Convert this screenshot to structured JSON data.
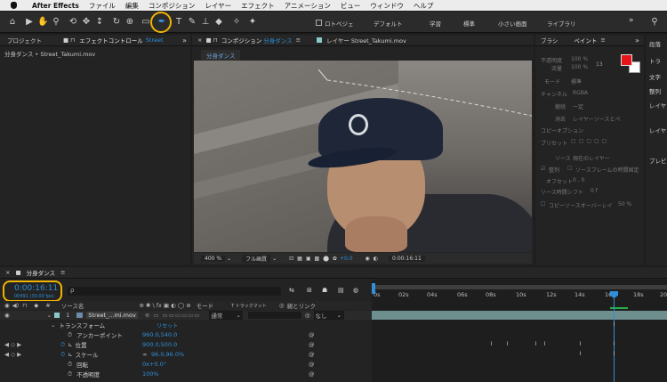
{
  "menubar": {
    "apple": "",
    "app": "After Effects",
    "items": [
      "ファイル",
      "編集",
      "コンポジション",
      "レイヤー",
      "エフェクト",
      "アニメーション",
      "ビュー",
      "ウィンドウ",
      "ヘルプ"
    ]
  },
  "toolbar": {
    "snap_label": "ロトベジェ",
    "workspaces": [
      "デフォルト",
      "学習",
      "標準",
      "小さい画面",
      "ライブラリ"
    ],
    "more": "»"
  },
  "project_panel": {
    "tab": "プロジェクト",
    "effect_tab": "エフェクトコントロール",
    "effect_layer": "Street",
    "breadcrumb": "分身ダンス • Street_Takumi.mov"
  },
  "comp_panel": {
    "tab_prefix": "コンポジション",
    "tab_comp": "分身ダンス",
    "layer_tab": "レイヤー Street_Takumi.mov",
    "chip": "分身ダンス",
    "zoom": "400 %",
    "resolution": "フル画質",
    "exposure": "+0.0",
    "timecode": "0:00:16:11"
  },
  "right_panel": {
    "brush_tab": "ブラシ",
    "paint_tab": "ペイント",
    "opacity_label": "不透明度",
    "opacity_val": "100 %",
    "flow_label": "流量",
    "flow_val": "100 %",
    "brush_size": "13",
    "mode_label": "モード",
    "mode_val": "標準",
    "channel_label": "チャンネル",
    "channel_val": "RGBA",
    "duration_label": "継続",
    "duration_val": "一定",
    "erase_label": "消去",
    "erase_val": "レイヤーソースとペ",
    "clone_header": "コピーオプション",
    "preset_label": "プリセット",
    "source_label": "ソース",
    "source_val": "現在のレイヤー",
    "align_label": "整列",
    "lock_label": "ソースフレームの時間固定",
    "offset_label": "オフセット",
    "offset_val": "0 , 0",
    "shift_label": "ソース時間シフト",
    "shift_val": "0 f",
    "overlay_label": "コピーソースオーバーレイ",
    "overlay_val": "50 %",
    "fg_color": "#e8141b",
    "bg_color": "#ffffff"
  },
  "far_right": {
    "items": [
      "段落",
      "トラ",
      "文字",
      "整列",
      "レイヤ",
      "レイヤ",
      "プレビ"
    ]
  },
  "timeline": {
    "tab": "分身ダンス",
    "timecode": "0:00:16:11",
    "frame_info": "00491 (30.00 fps)",
    "search_placeholder": "ρ",
    "headers": {
      "source": "ソース名",
      "mode": "モード",
      "track": "T トラックマット",
      "parent": "親とリンク"
    },
    "layer": {
      "index": "1",
      "name": "Street_...mi.mov",
      "mode": "通常",
      "parent": "なし"
    },
    "transform": {
      "label": "トランスフォーム",
      "reset": "リセット"
    },
    "props": [
      {
        "name": "アンカーポイント",
        "value": "960.0,540.0"
      },
      {
        "name": "位置",
        "value": "900.0,500.0"
      },
      {
        "name": "スケール",
        "value": "96.0,96.0%"
      },
      {
        "name": "回転",
        "value": "0x+0.0°"
      },
      {
        "name": "不透明度",
        "value": "100%"
      }
    ],
    "ruler": [
      "0s",
      "02s",
      "04s",
      "06s",
      "08s",
      "10s",
      "12s",
      "14s",
      "16s",
      "18s",
      "20"
    ],
    "playhead_sec": 16.37,
    "accent": "#2f8fd8",
    "highlight": "#f0b400"
  }
}
